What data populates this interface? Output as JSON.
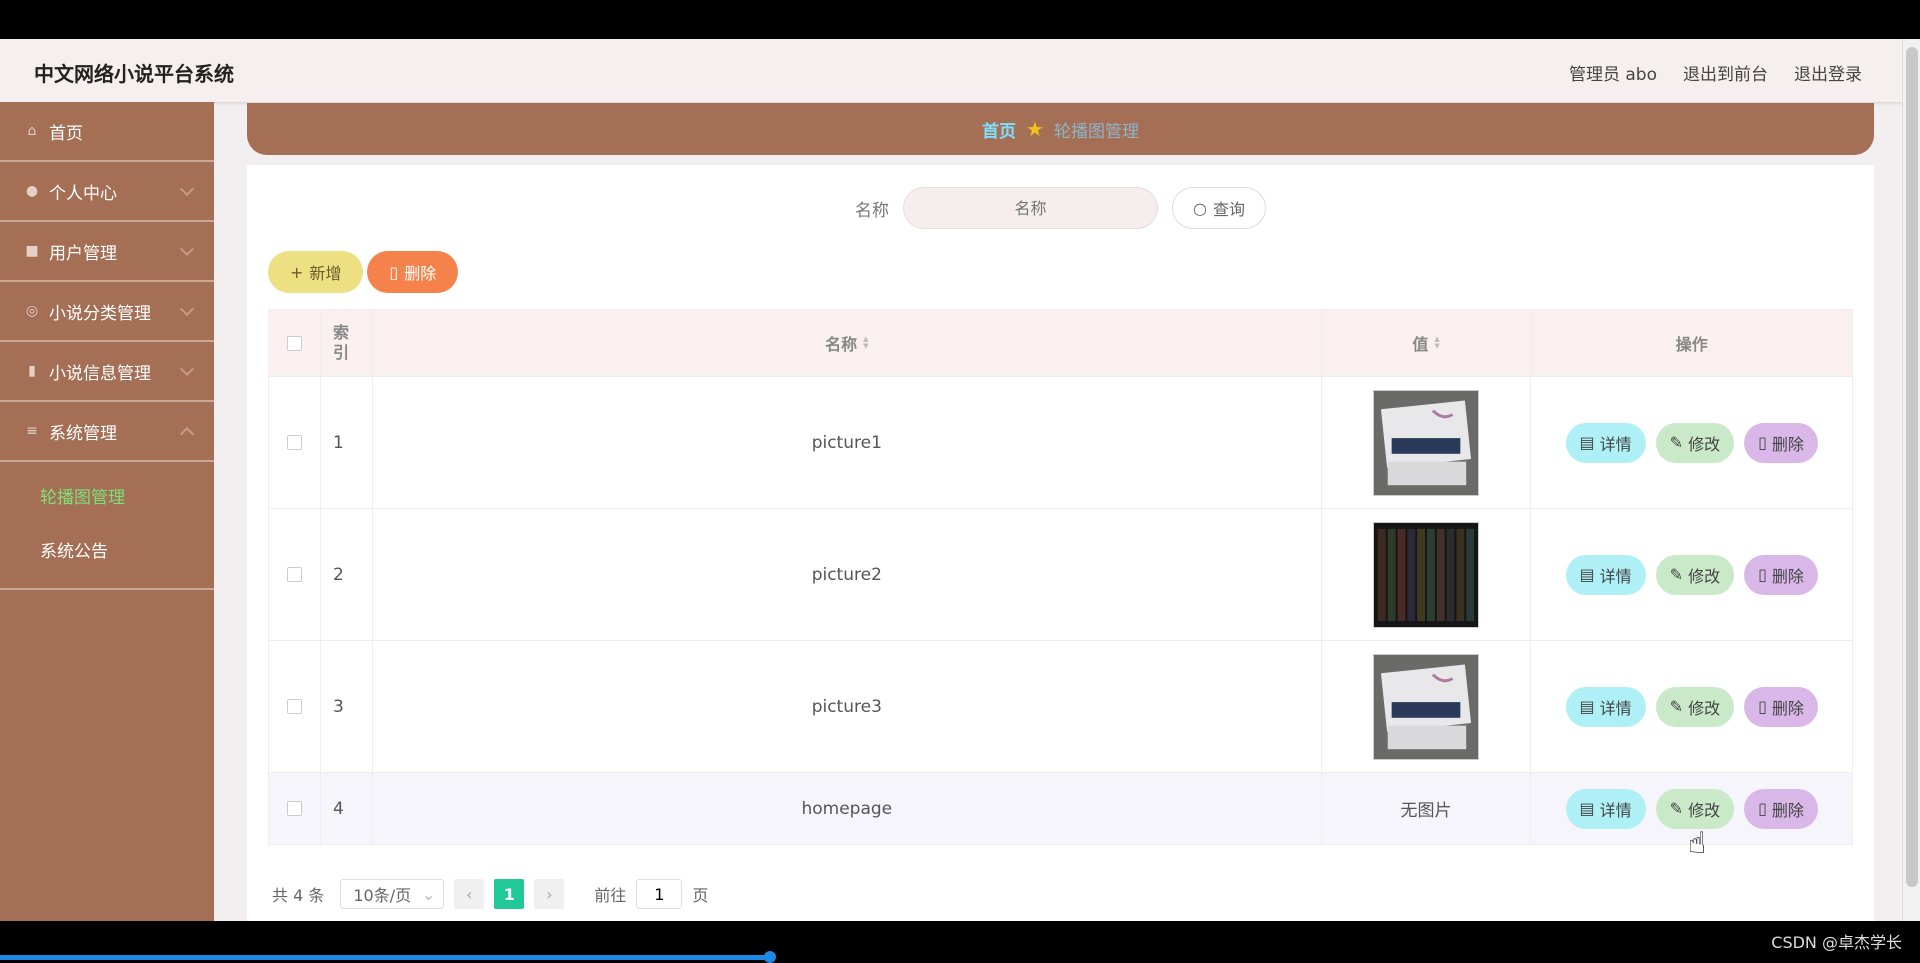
{
  "header": {
    "app_title": "中文网络小说平台系统",
    "links": [
      "管理员 abo",
      "退出到前台",
      "退出登录"
    ]
  },
  "sidebar": {
    "items": [
      {
        "label": "首页",
        "icon": "home-icon"
      },
      {
        "label": "个人中心",
        "icon": "user-icon"
      },
      {
        "label": "用户管理",
        "icon": "users-icon"
      },
      {
        "label": "小说分类管理",
        "icon": "category-icon"
      },
      {
        "label": "小说信息管理",
        "icon": "book-icon"
      },
      {
        "label": "系统管理",
        "icon": "menu-icon"
      }
    ],
    "sub_items": [
      "轮播图管理",
      "系统公告"
    ]
  },
  "breadcrumb": {
    "home": "首页",
    "current": "轮播图管理"
  },
  "search": {
    "label": "名称",
    "placeholder": "名称",
    "button": "查询"
  },
  "actions": {
    "add": "新增",
    "delete": "删除"
  },
  "table": {
    "headers": {
      "index": "索引",
      "name": "名称",
      "value": "值",
      "ops": "操作"
    },
    "rows": [
      {
        "index": "1",
        "name": "picture1",
        "value": "image"
      },
      {
        "index": "2",
        "name": "picture2",
        "value": "image"
      },
      {
        "index": "3",
        "name": "picture3",
        "value": "image"
      },
      {
        "index": "4",
        "name": "homepage",
        "value": "无图片"
      }
    ],
    "op_labels": {
      "detail": "详情",
      "edit": "修改",
      "delete": "删除"
    }
  },
  "pager": {
    "total": "共 4 条",
    "page_size": "10条/页",
    "current": "1",
    "goto_prefix": "前往",
    "goto_value": "1",
    "goto_suffix": "页"
  },
  "watermark": "CSDN @卓杰学长",
  "colors": {
    "sidebar": "#a46f55",
    "active_menu": "#7fe07a",
    "add_button": "#ece082",
    "delete_button": "#f5824a"
  }
}
